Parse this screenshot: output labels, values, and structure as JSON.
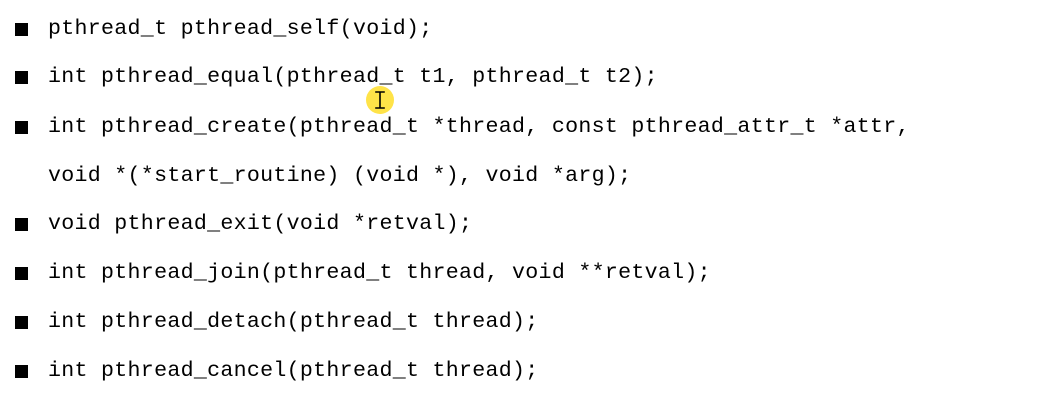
{
  "slide": {
    "items": [
      {
        "text": "pthread_t pthread_self(void);",
        "bullet": true
      },
      {
        "text": "int pthread_equal(pthread_t t1, pthread_t t2);",
        "bullet": true
      },
      {
        "text": "int pthread_create(pthread_t *thread, const pthread_attr_t *attr,",
        "bullet": true
      },
      {
        "text": "void *(*start_routine) (void *), void *arg);",
        "bullet": false
      },
      {
        "text": "void pthread_exit(void *retval);",
        "bullet": true
      },
      {
        "text": "int pthread_join(pthread_t thread, void **retval);",
        "bullet": true
      },
      {
        "text": "int pthread_detach(pthread_t thread);",
        "bullet": true
      },
      {
        "text": "int pthread_cancel(pthread_t thread);",
        "bullet": true
      }
    ],
    "bullet_icon": "square-bullet-icon",
    "cursor_icon": "text-cursor-icon",
    "colors": {
      "text": "#000000",
      "background": "#ffffff",
      "cursor_highlight": "#ffde28"
    }
  }
}
